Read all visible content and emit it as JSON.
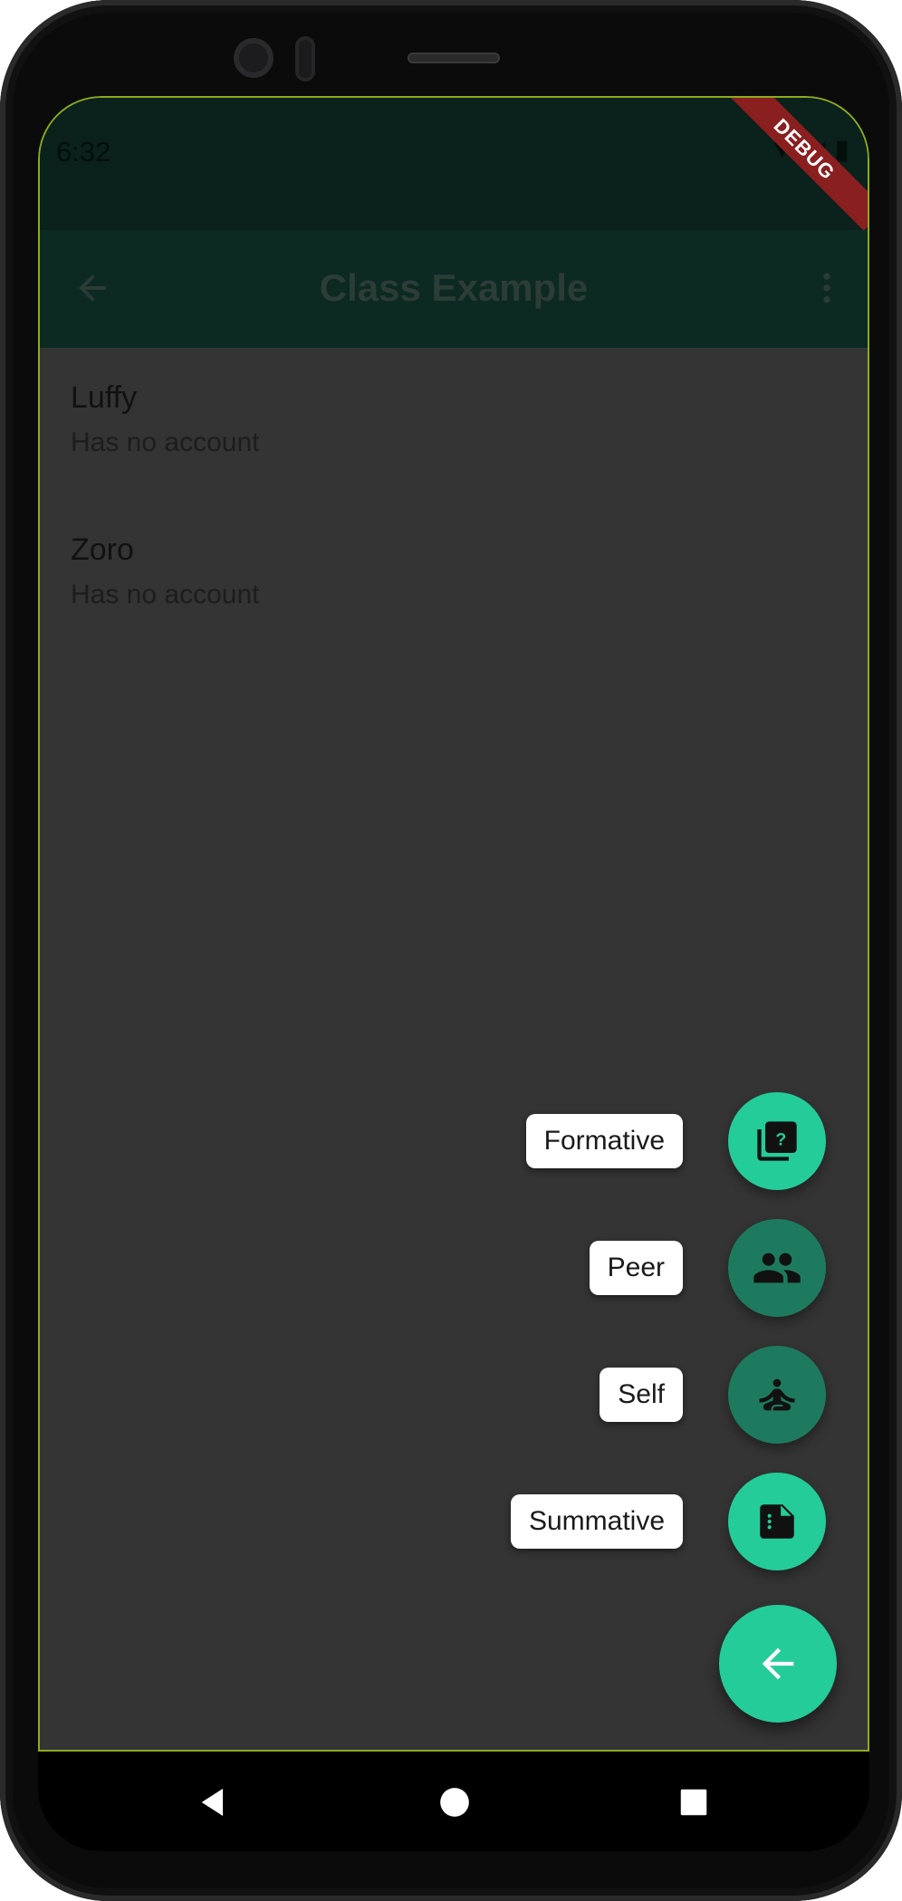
{
  "status": {
    "time": "6:32",
    "icons": [
      "wifi-icon",
      "signal-icon",
      "battery-icon"
    ]
  },
  "appbar": {
    "title": "Class Example",
    "back_icon": "arrow-back-icon",
    "menu_icon": "more-vert-icon"
  },
  "debug_banner": "DEBUG",
  "students": [
    {
      "name": "Luffy",
      "subtitle": "Has no account"
    },
    {
      "name": "Zoro",
      "subtitle": "Has no account"
    }
  ],
  "fab_menu": [
    {
      "label": "Formative",
      "icon": "quiz-icon",
      "color": "#24cc99"
    },
    {
      "label": "Peer",
      "icon": "people-icon",
      "color": "#1e7a5f"
    },
    {
      "label": "Self",
      "icon": "self-improvement-icon",
      "color": "#1e7a5f"
    },
    {
      "label": "Summative",
      "icon": "summarize-icon",
      "color": "#24cc99"
    }
  ],
  "main_fab": {
    "icon": "arrow-back-icon",
    "color": "#24cc99"
  },
  "nav": {
    "back": "nav-back-icon",
    "home": "nav-home-icon",
    "recents": "nav-recents-icon"
  },
  "colors": {
    "app_background": "#343434",
    "status_bar": "#0b211c",
    "app_bar": "#0c2a22",
    "accent": "#24cc99"
  }
}
